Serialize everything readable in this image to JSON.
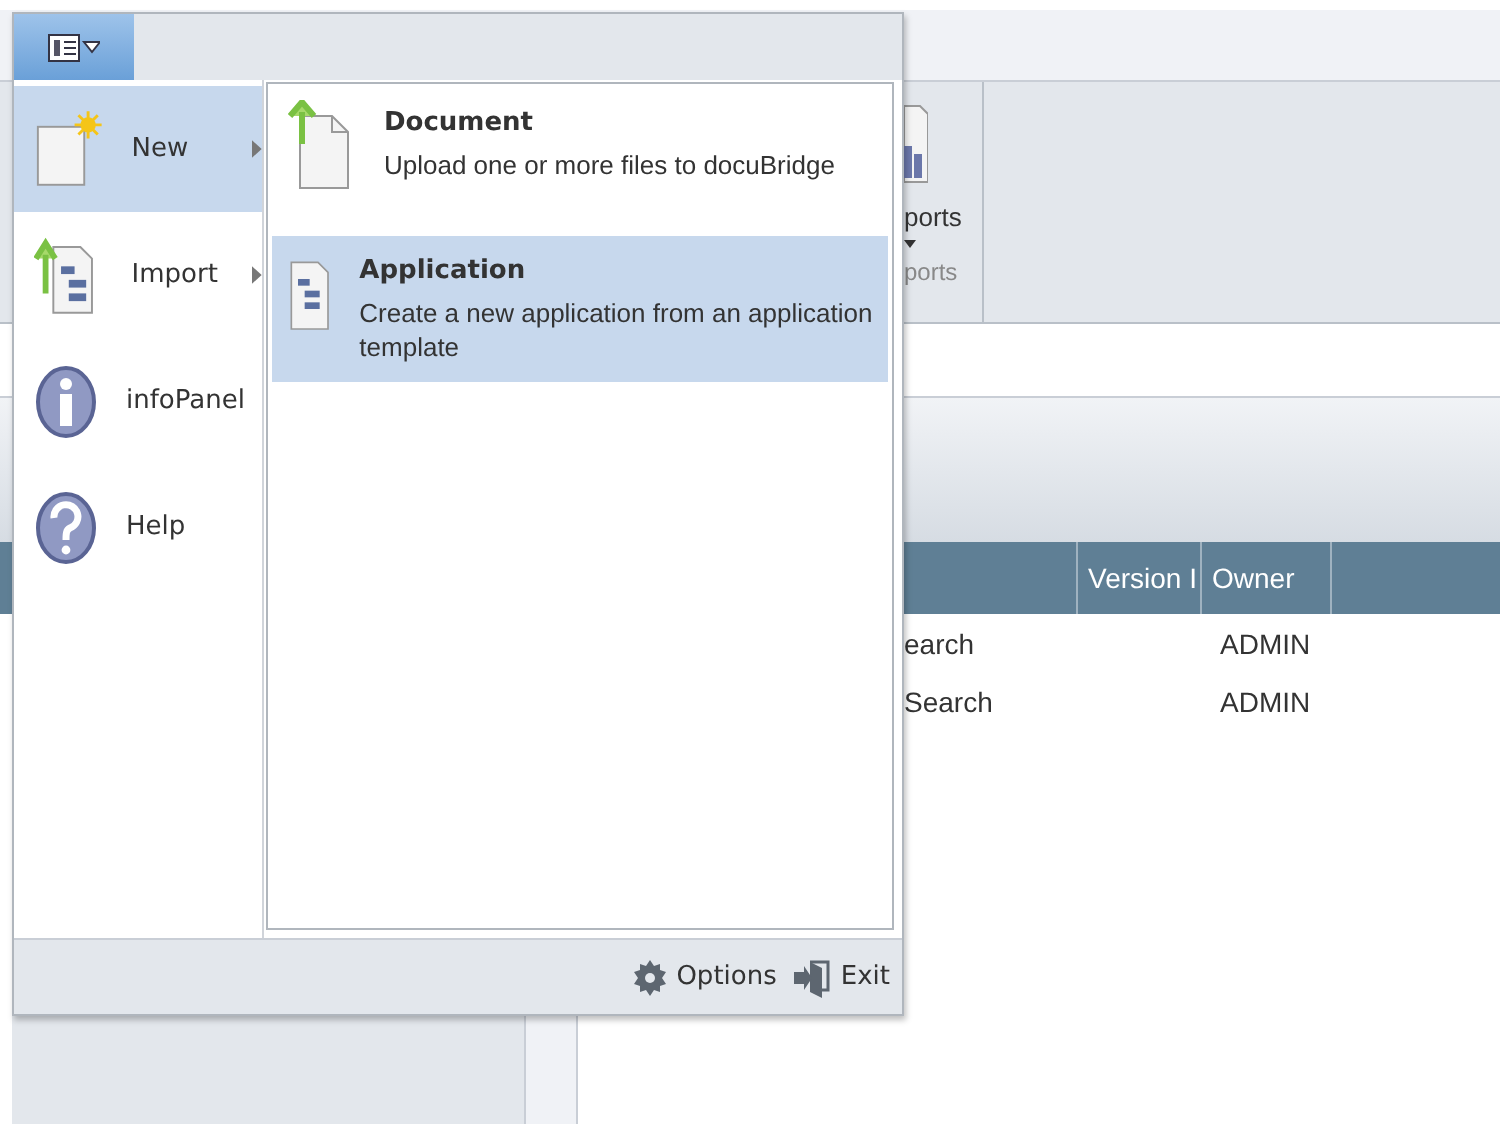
{
  "ribbon": {
    "button_label": "ports",
    "group_caption": "ports"
  },
  "table": {
    "columns": [
      "Version I",
      "Owner"
    ],
    "rows": [
      {
        "name": "earch",
        "owner": "ADMIN"
      },
      {
        "name": "Search",
        "owner": "ADMIN"
      }
    ]
  },
  "menu": {
    "items": [
      {
        "kind": "new",
        "label": "New",
        "has_submenu": true,
        "selected": true
      },
      {
        "kind": "import",
        "label": "Import",
        "has_submenu": true,
        "selected": false
      },
      {
        "kind": "info",
        "label": "infoPanel",
        "has_submenu": false,
        "selected": false
      },
      {
        "kind": "help",
        "label": "Help",
        "has_submenu": false,
        "selected": false
      }
    ],
    "submenu": [
      {
        "kind": "document",
        "title": "Document",
        "description": "Upload one or more files to docuBridge",
        "selected": false
      },
      {
        "kind": "application",
        "title": "Application",
        "description": "Create a new application from an application template",
        "selected": true
      }
    ],
    "footer": [
      {
        "kind": "options",
        "label": "Options"
      },
      {
        "kind": "exit",
        "label": "Exit"
      }
    ]
  }
}
